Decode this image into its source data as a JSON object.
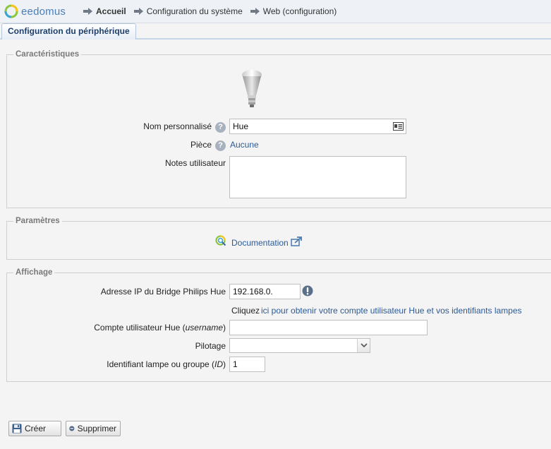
{
  "header": {
    "logo_text": "eedomus",
    "breadcrumb": [
      "Accueil",
      "Configuration du système",
      "Web (configuration)"
    ]
  },
  "tabs": [
    {
      "label": "Configuration du périphérique",
      "active": true
    }
  ],
  "characteristics": {
    "legend": "Caractéristiques",
    "icon": "lightbulb-icon",
    "custom_name_label": "Nom personnalisé",
    "custom_name_value": "Hue",
    "room_label": "Pièce",
    "room_value": "Aucune",
    "notes_label": "Notes utilisateur",
    "notes_value": ""
  },
  "parameters": {
    "legend": "Paramètres",
    "documentation_label": "Documentation"
  },
  "display": {
    "legend": "Affichage",
    "bridge_ip_label": "Adresse IP du Bridge Philips Hue",
    "bridge_ip_value": "192.168.0.",
    "hint_prefix": "Cliquez",
    "hint_link": "ici pour obtenir votre compte utilisateur Hue et vos identifiants lampes",
    "username_label_prefix": "Compte utilisateur Hue (",
    "username_label_em": "username",
    "username_label_suffix": ")",
    "username_value": "",
    "pilotage_label": "Pilotage",
    "pilotage_value": "",
    "lamp_id_label_prefix": "Identifiant lampe ou groupe (",
    "lamp_id_label_em": "ID",
    "lamp_id_label_suffix": ")",
    "lamp_id_value": "1"
  },
  "actions": {
    "create_label": "Créer",
    "delete_label": "Supprimer"
  },
  "colors": {
    "link": "#2b5a96",
    "tab_text": "#1e3f6b",
    "logo": "#4a7fb8",
    "warning_icon": "#5a6f8a"
  }
}
